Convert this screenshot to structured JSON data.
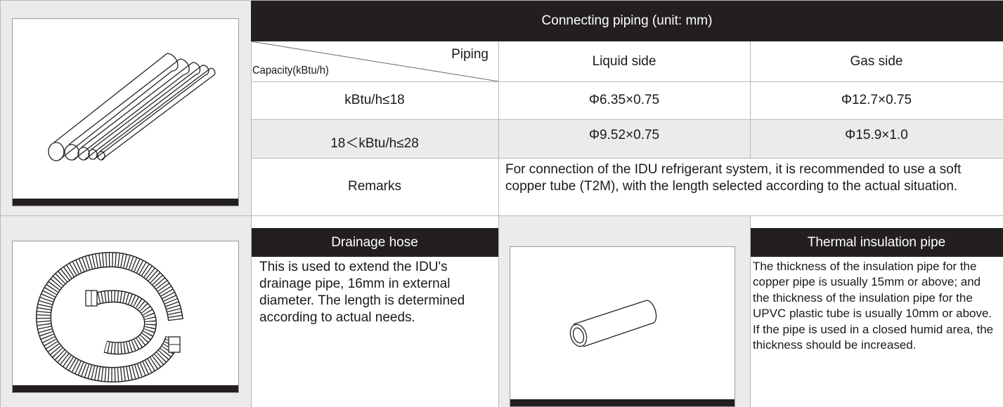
{
  "piping_table": {
    "title": "Connecting piping (unit: mm)",
    "header_piping": "Piping",
    "header_capacity": "Capacity(kBtu/h)",
    "header_liquid": "Liquid side",
    "header_gas": "Gas side",
    "rows": [
      {
        "capacity": "kBtu/h≤18",
        "liquid": "Φ6.35×0.75",
        "gas": "Φ12.7×0.75"
      },
      {
        "capacity": "18＜kBtu/h≤28",
        "liquid": "Φ9.52×0.75",
        "gas": "Φ15.9×1.0"
      }
    ],
    "remarks_label": "Remarks",
    "remarks_text": "For connection of the IDU refrigerant system, it is recommended to use a soft copper tube (T2M), with the length selected according to the actual situation."
  },
  "drainage": {
    "title": "Drainage hose",
    "text": "This is used to extend the IDU's drainage pipe, 16mm in external diameter. The length is determined according to actual needs."
  },
  "insulation": {
    "title": "Thermal insulation pipe",
    "text": "The thickness of the insulation pipe for the copper pipe is usually 15mm or above; and the thickness of the insulation pipe for the UPVC plastic tube is usually 10mm or above. If the pipe is used in a closed humid area, the thickness should be increased."
  },
  "colors": {
    "header_bg": "#231f20",
    "cell_grey": "#ebebeb",
    "text": "#1a1a1a"
  },
  "icons": [
    "copper-pipes-icon",
    "coiled-drainage-hose-icon",
    "insulation-pipe-icon"
  ]
}
